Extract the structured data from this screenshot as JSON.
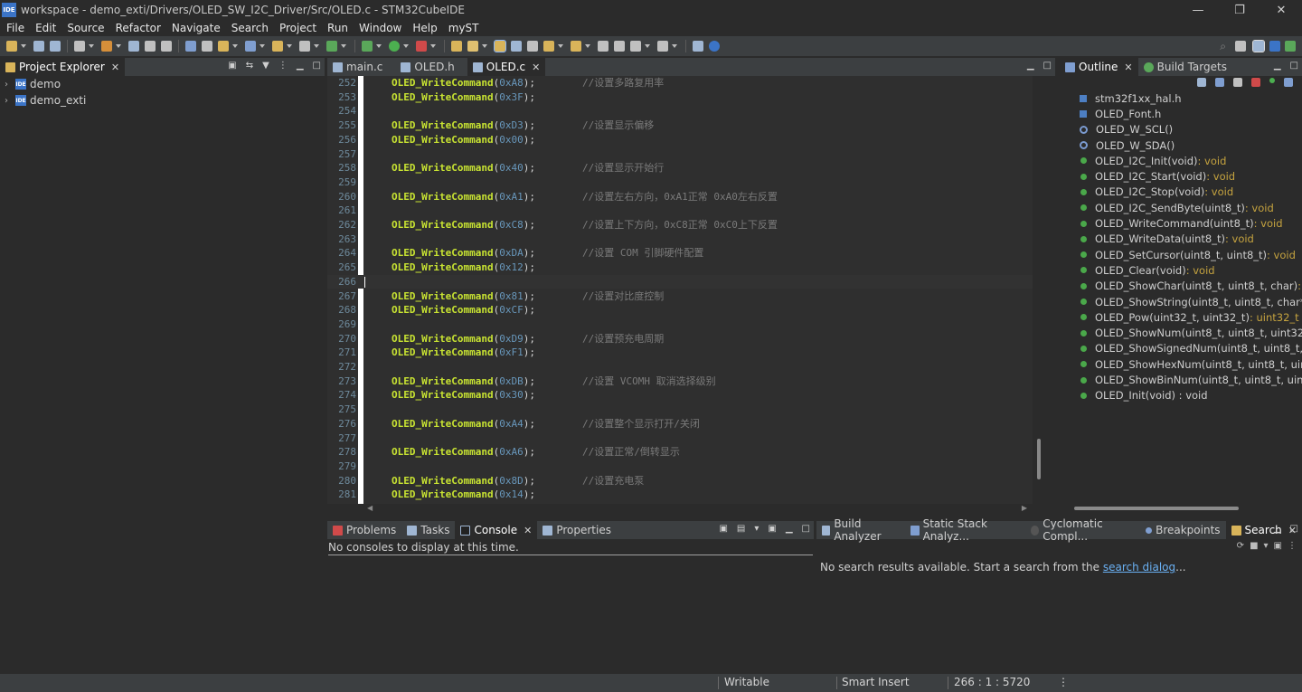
{
  "window": {
    "title": "workspace - demo_exti/Drivers/OLED_SW_I2C_Driver/Src/OLED.c - STM32CubeIDE",
    "app_icon_text": "IDE",
    "minimize": "—",
    "restore": "❐",
    "close": "✕"
  },
  "menu": [
    "File",
    "Edit",
    "Source",
    "Refactor",
    "Navigate",
    "Search",
    "Project",
    "Run",
    "Window",
    "Help",
    "myST"
  ],
  "explorer": {
    "tab_label": "Project Explorer",
    "projects": [
      "demo",
      "demo_exti"
    ]
  },
  "editor": {
    "tabs": [
      {
        "label": "main.c",
        "active": false
      },
      {
        "label": "OLED.h",
        "active": false
      },
      {
        "label": "OLED.c",
        "active": true
      }
    ],
    "function_name": "OLED_WriteCommand",
    "lines": [
      {
        "num": "252",
        "arg": "0xA8",
        "comment": "//设置多路复用率"
      },
      {
        "num": "253",
        "arg": "0x3F",
        "comment": ""
      },
      {
        "num": "254",
        "arg": "",
        "comment": ""
      },
      {
        "num": "255",
        "arg": "0xD3",
        "comment": "//设置显示偏移"
      },
      {
        "num": "256",
        "arg": "0x00",
        "comment": ""
      },
      {
        "num": "257",
        "arg": "",
        "comment": ""
      },
      {
        "num": "258",
        "arg": "0x40",
        "comment": "//设置显示开始行"
      },
      {
        "num": "259",
        "arg": "",
        "comment": ""
      },
      {
        "num": "260",
        "arg": "0xA1",
        "comment": "//设置左右方向，0xA1正常 0xA0左右反置"
      },
      {
        "num": "261",
        "arg": "",
        "comment": ""
      },
      {
        "num": "262",
        "arg": "0xC8",
        "comment": "//设置上下方向，0xC8正常 0xC0上下反置"
      },
      {
        "num": "263",
        "arg": "",
        "comment": ""
      },
      {
        "num": "264",
        "arg": "0xDA",
        "comment": "//设置 COM 引脚硬件配置"
      },
      {
        "num": "265",
        "arg": "0x12",
        "comment": ""
      },
      {
        "num": "266",
        "arg": "",
        "comment": ""
      },
      {
        "num": "267",
        "arg": "0x81",
        "comment": "//设置对比度控制"
      },
      {
        "num": "268",
        "arg": "0xCF",
        "comment": ""
      },
      {
        "num": "269",
        "arg": "",
        "comment": ""
      },
      {
        "num": "270",
        "arg": "0xD9",
        "comment": "//设置预充电周期"
      },
      {
        "num": "271",
        "arg": "0xF1",
        "comment": ""
      },
      {
        "num": "272",
        "arg": "",
        "comment": ""
      },
      {
        "num": "273",
        "arg": "0xDB",
        "comment": "//设置 VCOMH 取消选择级别"
      },
      {
        "num": "274",
        "arg": "0x30",
        "comment": ""
      },
      {
        "num": "275",
        "arg": "",
        "comment": ""
      },
      {
        "num": "276",
        "arg": "0xA4",
        "comment": "//设置整个显示打开/关闭"
      },
      {
        "num": "277",
        "arg": "",
        "comment": ""
      },
      {
        "num": "278",
        "arg": "0xA6",
        "comment": "//设置正常/倒转显示"
      },
      {
        "num": "279",
        "arg": "",
        "comment": ""
      },
      {
        "num": "280",
        "arg": "0x8D",
        "comment": "//设置充电泵"
      },
      {
        "num": "281",
        "arg": "0x14",
        "comment": ""
      }
    ]
  },
  "outline": {
    "tabs": [
      "Outline",
      "Build Targets"
    ],
    "items": [
      {
        "kind": "include",
        "name": "stm32f1xx_hal.h",
        "ret": ""
      },
      {
        "kind": "include",
        "name": "OLED_Font.h",
        "ret": ""
      },
      {
        "kind": "macro",
        "name": "OLED_W_SCL()",
        "ret": ""
      },
      {
        "kind": "macro",
        "name": "OLED_W_SDA()",
        "ret": ""
      },
      {
        "kind": "func",
        "name": "OLED_I2C_Init(void)",
        "ret": " : void"
      },
      {
        "kind": "func",
        "name": "OLED_I2C_Start(void)",
        "ret": " : void"
      },
      {
        "kind": "func",
        "name": "OLED_I2C_Stop(void)",
        "ret": " : void"
      },
      {
        "kind": "func",
        "name": "OLED_I2C_SendByte(uint8_t)",
        "ret": " : void"
      },
      {
        "kind": "func",
        "name": "OLED_WriteCommand(uint8_t)",
        "ret": " : void"
      },
      {
        "kind": "func",
        "name": "OLED_WriteData(uint8_t)",
        "ret": " : void"
      },
      {
        "kind": "func",
        "name": "OLED_SetCursor(uint8_t, uint8_t)",
        "ret": " : void"
      },
      {
        "kind": "func",
        "name": "OLED_Clear(void)",
        "ret": " : void"
      },
      {
        "kind": "func",
        "name": "OLED_ShowChar(uint8_t, uint8_t, char)",
        "ret": " : void"
      },
      {
        "kind": "func",
        "name": "OLED_ShowString(uint8_t, uint8_t, char*)",
        "ret": " : void"
      },
      {
        "kind": "func",
        "name": "OLED_Pow(uint32_t, uint32_t)",
        "ret": " : uint32_t"
      },
      {
        "kind": "func",
        "name": "OLED_ShowNum(uint8_t, uint8_t, uint32_t, uint8_t",
        "ret": ""
      },
      {
        "kind": "func",
        "name": "OLED_ShowSignedNum(uint8_t, uint8_t, int32_",
        "ret": ""
      },
      {
        "kind": "func",
        "name": "OLED_ShowHexNum(uint8_t, uint8_t, uint32_t,",
        "ret": ""
      },
      {
        "kind": "func",
        "name": "OLED_ShowBinNum(uint8_t, uint8_t, uint32_t, u",
        "ret": ""
      },
      {
        "kind": "func",
        "name": "OLED_Init(void) : void",
        "ret": ""
      }
    ]
  },
  "console": {
    "tabs": [
      "Problems",
      "Tasks",
      "Console",
      "Properties"
    ],
    "message": "No consoles to display at this time."
  },
  "search": {
    "tabs": [
      "Build Analyzer",
      "Static Stack Analyz...",
      "Cyclomatic Compl...",
      "Breakpoints",
      "Search"
    ],
    "message_prefix": "No search results available. Start a search from the ",
    "link": "search dialog",
    "message_suffix": "..."
  },
  "status": {
    "writable": "Writable",
    "insert_mode": "Smart Insert",
    "position": "266 : 1 : 5720"
  },
  "colors": {
    "function": "#c8e332",
    "hex_arg": "#6897bb",
    "comment": "#7a7a7a",
    "return_type": "#c5a33f"
  }
}
